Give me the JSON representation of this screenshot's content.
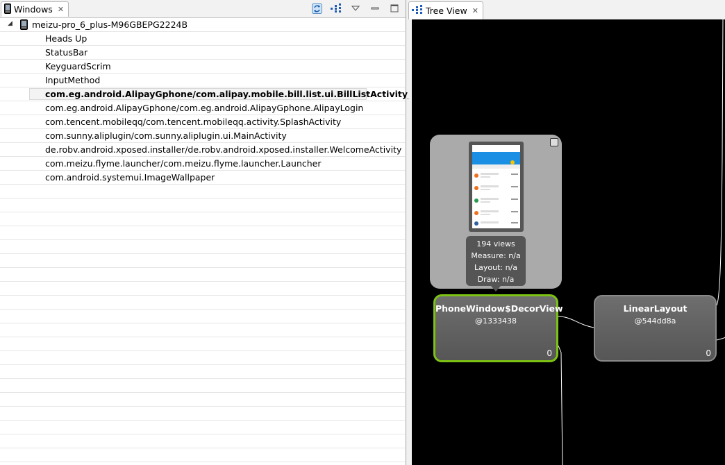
{
  "windows_panel": {
    "tab_label": "Windows",
    "device": "meizu-pro_6_plus-M96GBEPG2224B",
    "windows": [
      "Heads Up",
      "StatusBar",
      "KeyguardScrim",
      "InputMethod",
      "com.eg.android.AlipayGphone/com.alipay.mobile.bill.list.ui.BillListActivity_",
      "com.eg.android.AlipayGphone/com.eg.android.AlipayGphone.AlipayLogin",
      "com.tencent.mobileqq/com.tencent.mobileqq.activity.SplashActivity",
      "com.sunny.aliplugin/com.sunny.aliplugin.ui.MainActivity",
      "de.robv.android.xposed.installer/de.robv.android.xposed.installer.WelcomeActivity",
      "com.meizu.flyme.launcher/com.meizu.flyme.launcher.Launcher",
      "com.android.systemui.ImageWallpaper"
    ],
    "selected_index": 4
  },
  "tree_view": {
    "tab_label": "Tree View",
    "preview": {
      "views": "194 views",
      "measure": "Measure: n/a",
      "layout": "Layout: n/a",
      "draw": "Draw: n/a"
    },
    "nodes": {
      "decor": {
        "name": "PhoneWindow$DecorView",
        "id": "@1333438",
        "count": "0"
      },
      "linear": {
        "name": "LinearLayout",
        "id": "@544dd8a",
        "count": "0"
      }
    }
  },
  "colors": {
    "selected_node_border": "#7dc313",
    "canvas_background": "#000000"
  }
}
